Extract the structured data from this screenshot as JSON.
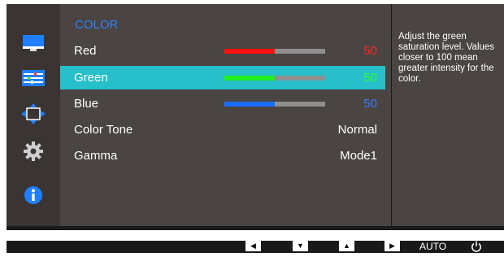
{
  "menu": {
    "title": "COLOR",
    "items": [
      {
        "label": "Red",
        "value": "50",
        "value_color": "#ff2a2a",
        "bar_color": "#ff1010",
        "level_percent": 50
      },
      {
        "label": "Green",
        "value": "50",
        "value_color": "#2cff2c",
        "bar_color": "#22f022",
        "level_percent": 50,
        "selected": true
      },
      {
        "label": "Blue",
        "value": "50",
        "value_color": "#3b7dff",
        "bar_color": "#1a6dff",
        "level_percent": 50
      },
      {
        "label": "Color Tone",
        "value": "Normal"
      },
      {
        "label": "Gamma",
        "value": "Mode1"
      }
    ]
  },
  "help": {
    "text": "Adjust the green saturation level. Values closer to 100 mean greater intensity for the color."
  },
  "sidebar": {
    "icons": [
      "monitor-icon",
      "settings-sliders-icon",
      "position-arrows-icon",
      "gear-icon",
      "info-icon"
    ]
  },
  "bottom": {
    "buttons": [
      "left-arrow",
      "down-arrow",
      "up-arrow",
      "right-arrow"
    ],
    "auto_label": "AUTO",
    "power": "power-icon"
  },
  "colors": {
    "accent": "#27bfc9",
    "title_blue": "#2f80ff",
    "panel": "#4a4442"
  }
}
